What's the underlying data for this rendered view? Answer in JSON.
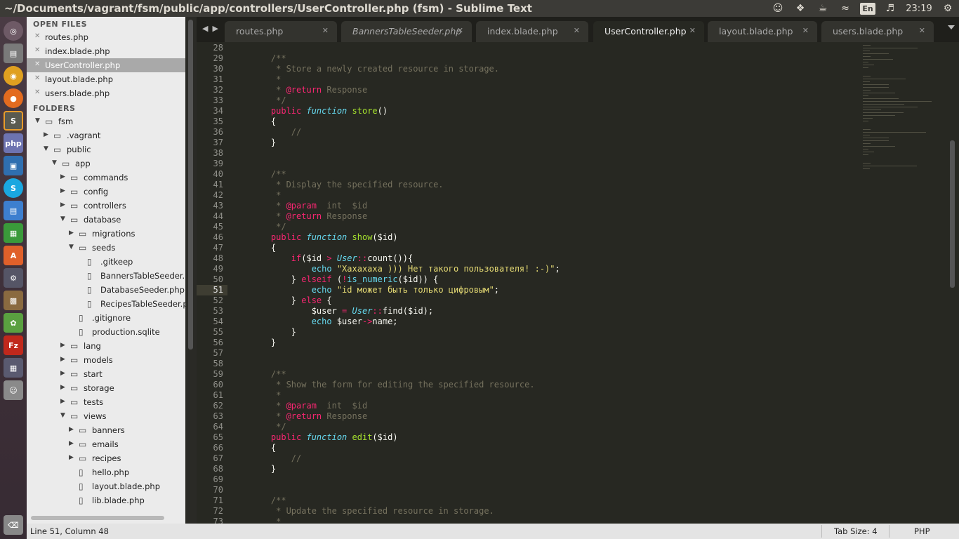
{
  "window": {
    "title": "~/Documents/vagrant/fsm/public/app/controllers/UserController.php (fsm) - Sublime Text"
  },
  "tray": {
    "lang": "En",
    "clock": "23:19"
  },
  "sidebar": {
    "open_files_header": "OPEN FILES",
    "folders_header": "FOLDERS",
    "open_files": [
      {
        "label": "routes.php"
      },
      {
        "label": "index.blade.php"
      },
      {
        "label": "UserController.php",
        "selected": true
      },
      {
        "label": "layout.blade.php"
      },
      {
        "label": "users.blade.php"
      }
    ],
    "tree": [
      {
        "label": "fsm",
        "type": "folder",
        "open": true,
        "depth": 0
      },
      {
        "label": ".vagrant",
        "type": "folder",
        "open": false,
        "depth": 1
      },
      {
        "label": "public",
        "type": "folder",
        "open": true,
        "depth": 1
      },
      {
        "label": "app",
        "type": "folder",
        "open": true,
        "depth": 2
      },
      {
        "label": "commands",
        "type": "folder",
        "open": false,
        "depth": 3
      },
      {
        "label": "config",
        "type": "folder",
        "open": false,
        "depth": 3
      },
      {
        "label": "controllers",
        "type": "folder",
        "open": false,
        "depth": 3
      },
      {
        "label": "database",
        "type": "folder",
        "open": true,
        "depth": 3
      },
      {
        "label": "migrations",
        "type": "folder",
        "open": false,
        "depth": 4
      },
      {
        "label": "seeds",
        "type": "folder",
        "open": true,
        "depth": 4
      },
      {
        "label": ".gitkeep",
        "type": "file",
        "depth": 5
      },
      {
        "label": "BannersTableSeeder.",
        "type": "file",
        "depth": 5
      },
      {
        "label": "DatabaseSeeder.php",
        "type": "file",
        "depth": 5
      },
      {
        "label": "RecipesTableSeeder.p",
        "type": "file",
        "depth": 5
      },
      {
        "label": ".gitignore",
        "type": "file",
        "depth": 4
      },
      {
        "label": "production.sqlite",
        "type": "file",
        "depth": 4
      },
      {
        "label": "lang",
        "type": "folder",
        "open": false,
        "depth": 3
      },
      {
        "label": "models",
        "type": "folder",
        "open": false,
        "depth": 3
      },
      {
        "label": "start",
        "type": "folder",
        "open": false,
        "depth": 3
      },
      {
        "label": "storage",
        "type": "folder",
        "open": false,
        "depth": 3
      },
      {
        "label": "tests",
        "type": "folder",
        "open": false,
        "depth": 3
      },
      {
        "label": "views",
        "type": "folder",
        "open": true,
        "depth": 3
      },
      {
        "label": "banners",
        "type": "folder",
        "open": false,
        "depth": 4
      },
      {
        "label": "emails",
        "type": "folder",
        "open": false,
        "depth": 4
      },
      {
        "label": "recipes",
        "type": "folder",
        "open": false,
        "depth": 4
      },
      {
        "label": "hello.php",
        "type": "file",
        "depth": 4
      },
      {
        "label": "layout.blade.php",
        "type": "file",
        "depth": 4
      },
      {
        "label": "lib.blade.php",
        "type": "file",
        "depth": 4
      }
    ]
  },
  "tabs": [
    {
      "label": "routes.php"
    },
    {
      "label": "BannersTableSeeder.php",
      "italic": true
    },
    {
      "label": "index.blade.php"
    },
    {
      "label": "UserController.php",
      "active": true
    },
    {
      "label": "layout.blade.php"
    },
    {
      "label": "users.blade.php"
    }
  ],
  "editor": {
    "first_line": 28,
    "current_line": 51,
    "lines": [
      [],
      [
        [
          "cm",
          "    /**"
        ]
      ],
      [
        [
          "cm",
          "     * Store a newly created resource in storage."
        ]
      ],
      [
        [
          "cm",
          "     *"
        ]
      ],
      [
        [
          "cm",
          "     * "
        ],
        [
          "k",
          "@return"
        ],
        [
          "cm",
          " Response"
        ]
      ],
      [
        [
          "cm",
          "     */"
        ]
      ],
      [
        [
          "k",
          "    public "
        ],
        [
          "f",
          "function "
        ],
        [
          "fn",
          "store"
        ],
        [
          "v",
          "()"
        ]
      ],
      [
        [
          "v",
          "    {"
        ]
      ],
      [
        [
          "cm",
          "        //"
        ]
      ],
      [
        [
          "v",
          "    }"
        ]
      ],
      [],
      [],
      [
        [
          "cm",
          "    /**"
        ]
      ],
      [
        [
          "cm",
          "     * Display the specified resource."
        ]
      ],
      [
        [
          "cm",
          "     *"
        ]
      ],
      [
        [
          "cm",
          "     * "
        ],
        [
          "k",
          "@param"
        ],
        [
          "cm",
          "  int  $id"
        ]
      ],
      [
        [
          "cm",
          "     * "
        ],
        [
          "k",
          "@return"
        ],
        [
          "cm",
          " Response"
        ]
      ],
      [
        [
          "cm",
          "     */"
        ]
      ],
      [
        [
          "k",
          "    public "
        ],
        [
          "f",
          "function "
        ],
        [
          "fn",
          "show"
        ],
        [
          "v",
          "($id)"
        ]
      ],
      [
        [
          "v",
          "    {"
        ]
      ],
      [
        [
          "k",
          "        if"
        ],
        [
          "v",
          "($id "
        ],
        [
          "o",
          ">"
        ],
        [
          "v",
          " "
        ],
        [
          "cls",
          "User"
        ],
        [
          "o",
          "::"
        ],
        [
          "v",
          "count()){"
        ]
      ],
      [
        [
          "c",
          "            echo "
        ],
        [
          "s",
          "\"Хахахаха ))) Нет такого пользователя! :-)\""
        ],
        [
          "v",
          ";"
        ]
      ],
      [
        [
          "v",
          "        } "
        ],
        [
          "k",
          "elseif"
        ],
        [
          "v",
          " ("
        ],
        [
          "o",
          "!"
        ],
        [
          "c",
          "is_numeric"
        ],
        [
          "v",
          "($id)) {"
        ]
      ],
      [
        [
          "c",
          "            echo "
        ],
        [
          "s",
          "\"id может быть только цифровым\""
        ],
        [
          "v",
          ";"
        ]
      ],
      [
        [
          "v",
          "        } "
        ],
        [
          "k",
          "else"
        ],
        [
          "v",
          " {"
        ]
      ],
      [
        [
          "v",
          "            $user "
        ],
        [
          "o",
          "="
        ],
        [
          "v",
          " "
        ],
        [
          "cls",
          "User"
        ],
        [
          "o",
          "::"
        ],
        [
          "v",
          "find($id);"
        ]
      ],
      [
        [
          "c",
          "            echo "
        ],
        [
          "v",
          "$user"
        ],
        [
          "o",
          "->"
        ],
        [
          "v",
          "name;"
        ]
      ],
      [
        [
          "v",
          "        }"
        ]
      ],
      [
        [
          "v",
          "    }"
        ]
      ],
      [],
      [],
      [
        [
          "cm",
          "    /**"
        ]
      ],
      [
        [
          "cm",
          "     * Show the form for editing the specified resource."
        ]
      ],
      [
        [
          "cm",
          "     *"
        ]
      ],
      [
        [
          "cm",
          "     * "
        ],
        [
          "k",
          "@param"
        ],
        [
          "cm",
          "  int  $id"
        ]
      ],
      [
        [
          "cm",
          "     * "
        ],
        [
          "k",
          "@return"
        ],
        [
          "cm",
          " Response"
        ]
      ],
      [
        [
          "cm",
          "     */"
        ]
      ],
      [
        [
          "k",
          "    public "
        ],
        [
          "f",
          "function "
        ],
        [
          "fn",
          "edit"
        ],
        [
          "v",
          "($id)"
        ]
      ],
      [
        [
          "v",
          "    {"
        ]
      ],
      [
        [
          "cm",
          "        //"
        ]
      ],
      [
        [
          "v",
          "    }"
        ]
      ],
      [],
      [],
      [
        [
          "cm",
          "    /**"
        ]
      ],
      [
        [
          "cm",
          "     * Update the specified resource in storage."
        ]
      ],
      [
        [
          "cm",
          "     *"
        ]
      ]
    ]
  },
  "status": {
    "position": "Line 51, Column 48",
    "tab_size": "Tab Size: 4",
    "syntax": "PHP"
  }
}
